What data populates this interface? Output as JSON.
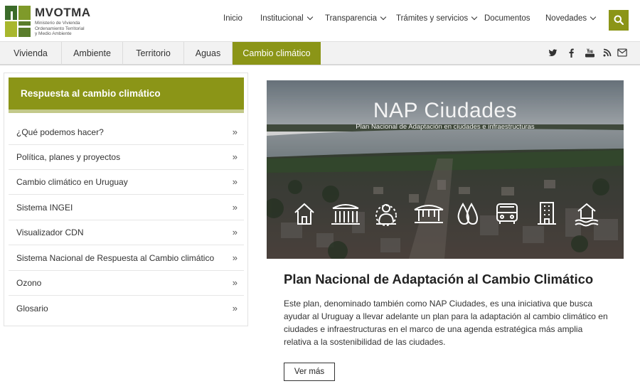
{
  "header": {
    "logo_title": "MVOTMA",
    "logo_sub": [
      "Ministerio de Vivienda",
      "Ordenamiento Territorial",
      "y Medio Ambiente"
    ],
    "nav": [
      {
        "label": "Inicio",
        "dropdown": false
      },
      {
        "label": "Institucional",
        "dropdown": true
      },
      {
        "label": "Transparencia",
        "dropdown": true
      },
      {
        "label": "Trámites y servicios",
        "dropdown": true
      },
      {
        "label": "Documentos",
        "dropdown": false
      },
      {
        "label": "Novedades",
        "dropdown": true
      }
    ],
    "search_icon": "search-icon"
  },
  "subnav": {
    "tabs": [
      "Vivienda",
      "Ambiente",
      "Territorio",
      "Aguas",
      "Cambio climático"
    ],
    "active_tab": "Cambio climático",
    "social_icons": [
      "twitter-icon",
      "facebook-icon",
      "youtube-icon",
      "rss-icon",
      "email-icon"
    ]
  },
  "sidebar": {
    "heading": "Respuesta al cambio climático",
    "items": [
      "¿Qué podemos hacer?",
      "Política, planes y proyectos",
      "Cambio climático en Uruguay",
      "Sistema INGEI",
      "Visualizador CDN",
      "Sistema Nacional de Respuesta al Cambio climático",
      "Ozono",
      "Glosario"
    ],
    "item_icon": "double-chevron-right-icon"
  },
  "hero": {
    "title": "NAP Ciudades",
    "subtitle": "Plan Nacional de Adaptación en ciudades e infraestructuras",
    "icons": [
      "house-icon",
      "stadium-icon",
      "person-icon",
      "bridge-icon",
      "water-drops-icon",
      "bus-icon",
      "building-icon",
      "flooded-house-icon"
    ]
  },
  "article": {
    "title": "Plan Nacional de Adaptación al Cambio Climático",
    "body": "Este plan, denominado también como NAP Ciudades, es una iniciativa que busca ayudar al Uruguay a llevar adelante un plan para la adaptación al cambio climático en ciudades e infraestructuras en el marco de una agenda estratégica más amplia relativa a la sostenibilidad de las ciudades.",
    "button": "Ver más"
  },
  "colors": {
    "accent": "#8b9517",
    "accent_light": "#c3c98a",
    "subnav_bg": "#f2f2f2"
  }
}
